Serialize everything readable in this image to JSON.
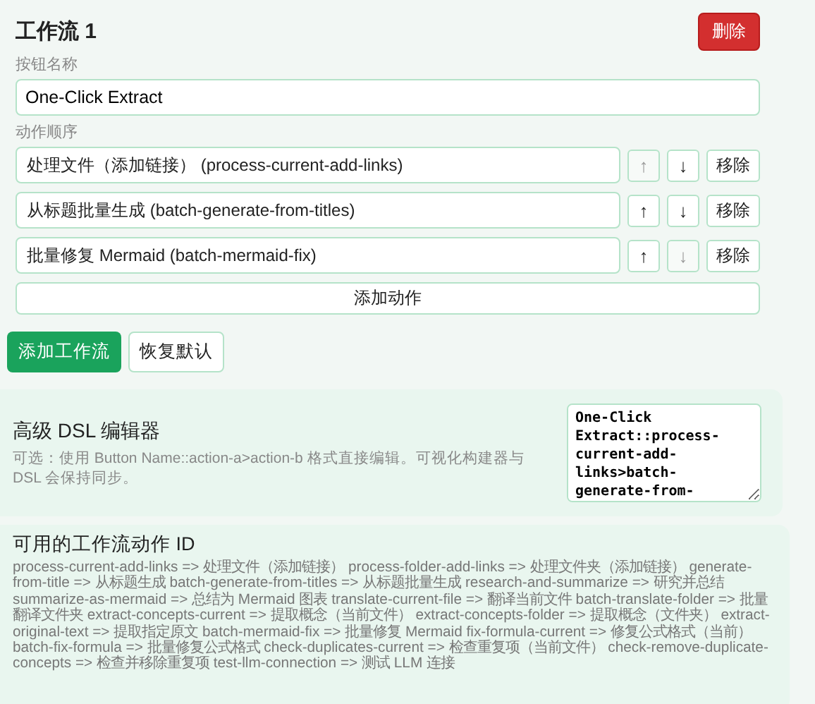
{
  "workflow": {
    "title": "工作流 1",
    "delete_button": "删除",
    "name_label": "按钮名称",
    "name_value": "One-Click Extract",
    "actions_label": "动作顺序",
    "actions": [
      {
        "label": "处理文件（添加链接） (process-current-add-links)",
        "up_disabled": true,
        "down_disabled": false,
        "remove": "移除",
        "up": "↑",
        "down": "↓"
      },
      {
        "label": "从标题批量生成 (batch-generate-from-titles)",
        "up_disabled": false,
        "down_disabled": false,
        "remove": "移除",
        "up": "↑",
        "down": "↓"
      },
      {
        "label": "批量修复 Mermaid (batch-mermaid-fix)",
        "up_disabled": false,
        "down_disabled": true,
        "remove": "移除",
        "up": "↑",
        "down": "↓"
      }
    ],
    "add_action": "添加动作"
  },
  "buttons": {
    "add_workflow": "添加工作流",
    "restore": "恢复默认"
  },
  "dsl": {
    "title": "高级 DSL 编辑器",
    "description": "可选：使用 Button Name::action-a>action-b 格式直接编辑。可视化构建器与 DSL 会保持同步。",
    "value": "One-Click Extract::process-current-add-links>batch-generate-from-"
  },
  "ids": {
    "title": "可用的工作流动作 ID",
    "text": "process-current-add-links => 处理文件（添加链接） process-folder-add-links => 处理文件夹（添加链接） generate-from-title => 从标题生成 batch-generate-from-titles => 从标题批量生成 research-and-summarize => 研究并总结 summarize-as-mermaid => 总结为 Mermaid 图表 translate-current-file => 翻译当前文件 batch-translate-folder => 批量翻译文件夹 extract-concepts-current => 提取概念（当前文件） extract-concepts-folder => 提取概念（文件夹） extract-original-text => 提取指定原文 batch-mermaid-fix => 批量修复 Mermaid fix-formula-current => 修复公式格式（当前） batch-fix-formula => 批量修复公式格式 check-duplicates-current => 检查重复项（当前文件） check-remove-duplicate-concepts => 检查并移除重复项 test-llm-connection => 测试 LLM 连接"
  }
}
